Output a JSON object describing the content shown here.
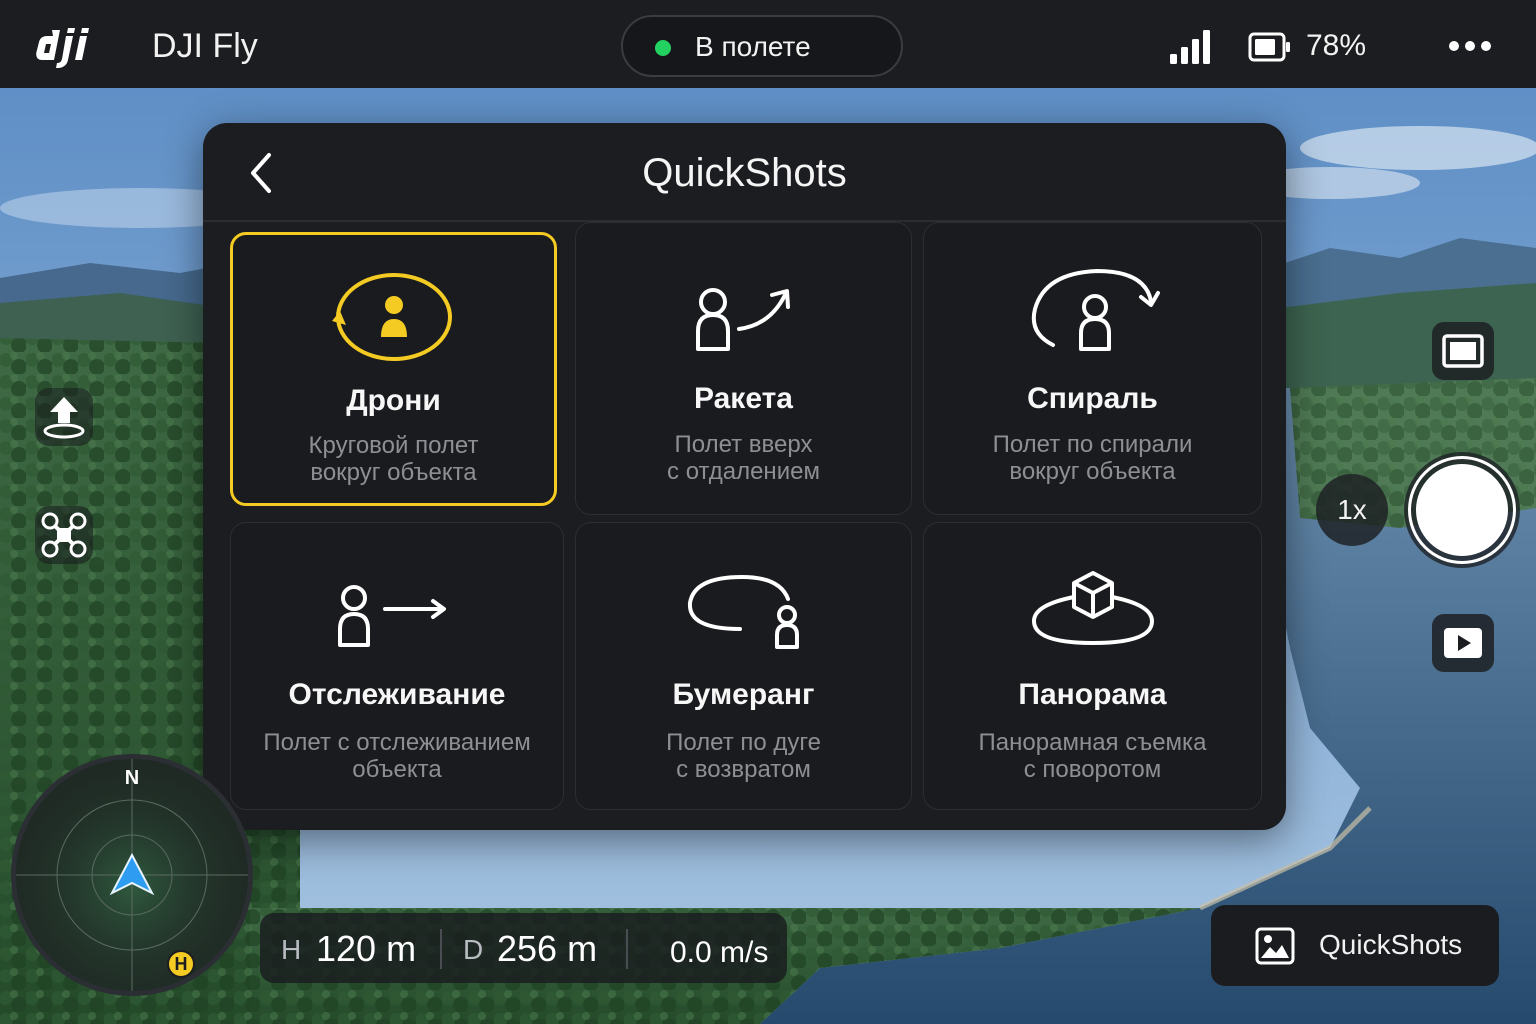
{
  "header": {
    "brand_logo": "dji-logo",
    "app_title": "DJI Fly",
    "flight_status": "В полете",
    "status_color": "#23d160",
    "signal_icon": "signal-bars-icon",
    "battery_icon": "battery-icon",
    "battery_percent": "78%",
    "menu_icon": "more-dots-icon"
  },
  "left_tools": [
    {
      "icon": "return-to-home-icon"
    },
    {
      "icon": "drone-icon"
    }
  ],
  "quickshots_panel": {
    "title": "QuickShots",
    "back_icon": "chevron-left-icon",
    "accent_color": "#f4cb23",
    "modes": [
      {
        "icon": "orbit-icon",
        "name": "Дрони",
        "desc_line1": "Круговой полет",
        "desc_line2": "вокруг объекта",
        "selected": true
      },
      {
        "icon": "rocket-icon",
        "name": "Ракета",
        "desc_line1": "Полет вверх",
        "desc_line2": "с отдалением",
        "selected": false
      },
      {
        "icon": "spiral-icon",
        "name": "Спираль",
        "desc_line1": "Полет по спирали",
        "desc_line2": "вокруг объекта",
        "selected": false
      },
      {
        "icon": "track-icon",
        "name": "Отслеживание",
        "desc_line1": "Полет с отслеживанием",
        "desc_line2": "объекта",
        "selected": false
      },
      {
        "icon": "boomerang-icon",
        "name": "Бумеранг",
        "desc_line1": "Полет по дуге",
        "desc_line2": "с возвратом",
        "selected": false
      },
      {
        "icon": "panorama-icon",
        "name": "Панорама",
        "desc_line1": "Панорамная съемка",
        "desc_line2": "с поворотом",
        "selected": false
      }
    ]
  },
  "camera_controls": {
    "zoom": "1x",
    "aspect_icon": "frame-icon",
    "shutter_icon": "shutter-button",
    "playback_icon": "playback-icon"
  },
  "compass": {
    "north_label": "N",
    "home_label": "H",
    "home_color": "#f4cb23"
  },
  "telemetry": {
    "height_label": "H",
    "height_value": "120 m",
    "distance_label": "D",
    "distance_value": "256 m",
    "speed_value": "0.0 m/s"
  },
  "bottom_button": {
    "icon": "image-icon",
    "label": "QuickShots"
  }
}
